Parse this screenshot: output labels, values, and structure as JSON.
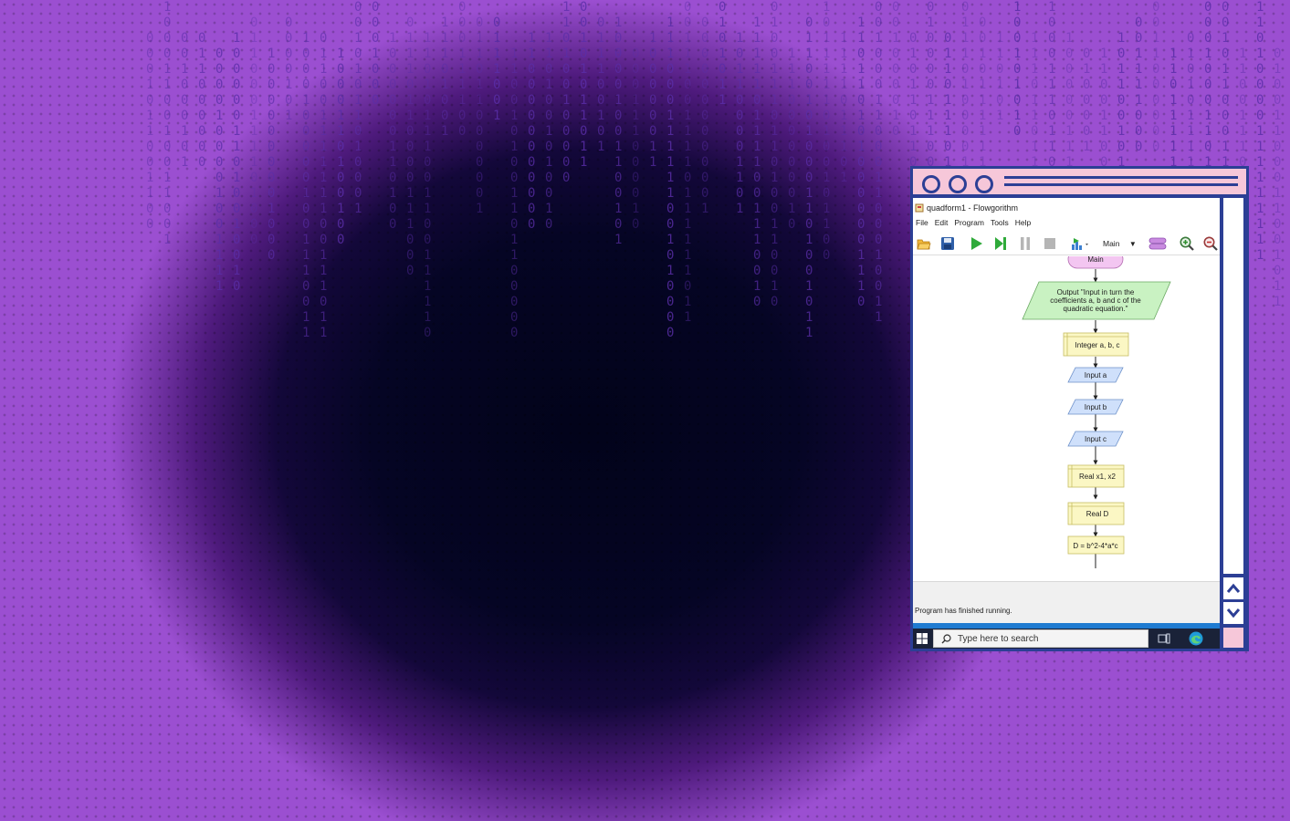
{
  "window": {
    "app_title": "quadform1 - Flowgorithm",
    "menu": [
      "File",
      "Edit",
      "Program",
      "Tools",
      "Help"
    ],
    "function_select": "Main",
    "status": "Program has finished running."
  },
  "flowchart": {
    "start": "Main",
    "output": [
      "Output \"Input in turn the",
      "coefficients a, b and c of the",
      "quadratic equation.\""
    ],
    "declare_int": "Integer a, b, c",
    "input_a": "Input a",
    "input_b": "Input b",
    "input_c": "Input c",
    "declare_real_x": "Real x1, x2",
    "declare_real_d": "Real D",
    "assign_d": "D = b^2-4*a*c"
  },
  "taskbar": {
    "search_placeholder": "Type here to search"
  },
  "colors": {
    "window_frame": "#2c3f95",
    "window_titlebar": "#f6c7d9",
    "start_node": "#f3c6f1",
    "output_node": "#c9f2c2",
    "declare_node": "#fbf7c4",
    "input_node": "#cfe0fb",
    "taskbar": "#1a2238"
  },
  "icons": [
    "open-folder-icon",
    "save-icon",
    "run-icon",
    "step-icon",
    "pause-icon",
    "stop-icon",
    "chart-icon",
    "shape-icon",
    "zoom-in-icon",
    "zoom-out-icon",
    "windows-start-icon",
    "search-icon",
    "task-view-icon",
    "edge-icon",
    "chevron-up-icon",
    "chevron-down-icon"
  ]
}
